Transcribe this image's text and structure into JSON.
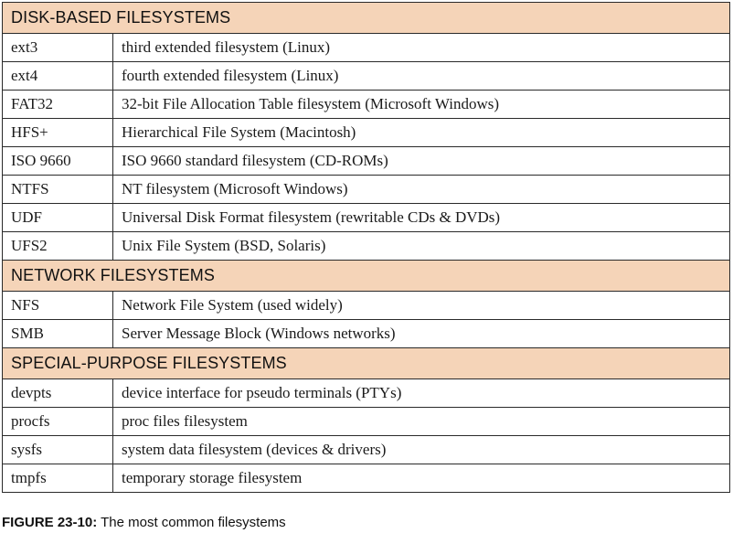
{
  "sections": [
    {
      "title": "DISK-BASED FILESYSTEMS",
      "rows": [
        {
          "name": "ext3",
          "description": "third extended filesystem (Linux)"
        },
        {
          "name": "ext4",
          "description": "fourth extended filesystem (Linux)"
        },
        {
          "name": "FAT32",
          "description": "32-bit File Allocation Table filesystem (Microsoft Windows)"
        },
        {
          "name": "HFS+",
          "description": "Hierarchical File System (Macintosh)"
        },
        {
          "name": "ISO 9660",
          "description": "ISO 9660 standard filesystem (CD-ROMs)"
        },
        {
          "name": "NTFS",
          "description": "NT filesystem (Microsoft Windows)"
        },
        {
          "name": "UDF",
          "description": "Universal Disk Format filesystem (rewritable CDs & DVDs)"
        },
        {
          "name": "UFS2",
          "description": "Unix File System (BSD, Solaris)"
        }
      ]
    },
    {
      "title": "NETWORK FILESYSTEMS",
      "rows": [
        {
          "name": "NFS",
          "description": "Network File System (used widely)"
        },
        {
          "name": "SMB",
          "description": "Server Message Block (Windows networks)"
        }
      ]
    },
    {
      "title": "SPECIAL-PURPOSE FILESYSTEMS",
      "rows": [
        {
          "name": "devpts",
          "description": "device interface for pseudo terminals (PTYs)"
        },
        {
          "name": "procfs",
          "description": "proc files filesystem"
        },
        {
          "name": "sysfs",
          "description": "system data filesystem (devices & drivers)"
        },
        {
          "name": "tmpfs",
          "description": "temporary storage filesystem"
        }
      ]
    }
  ],
  "caption": {
    "label": "FIGURE 23-10:",
    "text": "The most common filesystems"
  },
  "colors": {
    "section_header_bg": "#f5d4b8",
    "border": "#2a2a2a"
  }
}
